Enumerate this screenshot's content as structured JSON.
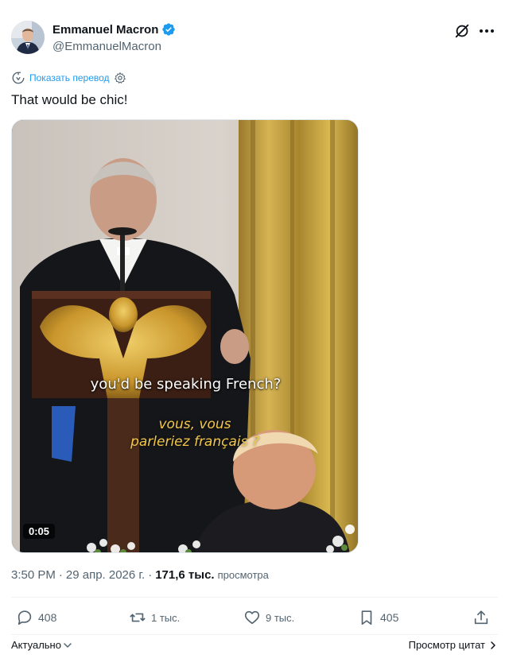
{
  "author": {
    "display_name": "Emmanuel Macron",
    "handle": "@EmmanuelMacron",
    "verified": true
  },
  "translate": {
    "link_label": "Показать перевод"
  },
  "tweet": {
    "text": "That would be chic!"
  },
  "media": {
    "type": "video",
    "caption_en": "you'd be speaking French?",
    "caption_fr_line1": "vous, vous",
    "caption_fr_line2": "parleriez français ?",
    "duration": "0:05"
  },
  "meta": {
    "time": "3:50 PM",
    "separator": "·",
    "date": "29 апр. 2026 г.",
    "separator2": "·",
    "views_count": "171,6 тыс.",
    "views_label": "просмотра"
  },
  "actions": {
    "replies": "408",
    "reposts": "1 тыс.",
    "likes": "9 тыс.",
    "bookmarks": "405"
  },
  "footer": {
    "sort_label": "Актуально",
    "quotes_label": "Просмотр цитат"
  },
  "colors": {
    "accent": "#1d9bf0",
    "text": "#0f1419",
    "secondary": "#536471",
    "caption_fr": "#f2c74a"
  },
  "icons": {
    "verified": "verified-badge-icon",
    "grok": "grok-icon",
    "more": "more-icon",
    "translate": "translate-icon",
    "settings": "gear-icon",
    "reply": "reply-icon",
    "repost": "repost-icon",
    "like": "heart-icon",
    "bookmark": "bookmark-icon",
    "share": "share-icon"
  }
}
